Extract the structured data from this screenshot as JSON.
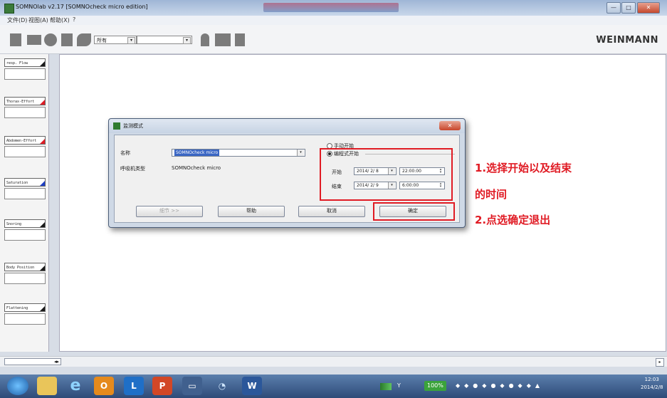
{
  "window": {
    "title": "SOMNOlab v2.17  [SOMNOcheck micro edition]",
    "controls": {
      "minimize": "—",
      "maximize": "□",
      "close": "✕"
    }
  },
  "menu": {
    "file": "文件(D)",
    "view": "视图(A)",
    "help": "帮助(X)",
    "question": "?"
  },
  "toolbar": {
    "filter_value": "所有",
    "brand": "WEINMANN"
  },
  "sidebar": {
    "items": [
      {
        "label": "resp. Flow"
      },
      {
        "label": "Thorax-Effort"
      },
      {
        "label": "Abdomen-Effort"
      },
      {
        "label": "Saturation"
      },
      {
        "label": "Snoring"
      },
      {
        "label": "Body Position"
      },
      {
        "label": "Flattening"
      }
    ]
  },
  "dialog": {
    "title": "监测模式",
    "name_label": "名称",
    "name_value": "SOMNOcheck micro",
    "device_type_label": "呼吸机类型",
    "device_type_value": "SOMNOcheck micro",
    "manual_start_label": "手动开始",
    "programmed_start_label": "编程式开始",
    "start_label": "开始",
    "start_date": "2014/ 2/ 8",
    "start_time": "22:00:00",
    "end_label": "结束",
    "end_date": "2014/ 2/ 9",
    "end_time": "6:00:00",
    "buttons": {
      "details": "细节 >>",
      "help": "帮助",
      "cancel": "取消",
      "ok": "确定"
    }
  },
  "annotations": {
    "line1": "1.选择开始以及结束",
    "line2": "的时间",
    "line3": "2.点选确定退出"
  },
  "colors": {
    "annotation": "#e01b24",
    "selection": "#3a66c4"
  },
  "taskbar": {
    "apps": [
      "start-orb",
      "explorer",
      "ie",
      "outlook",
      "lync",
      "powerpoint",
      "remote-desktop",
      "media-player",
      "word"
    ],
    "battery": "100%",
    "clock_time": "12:03",
    "clock_date": "2014/2/8"
  }
}
